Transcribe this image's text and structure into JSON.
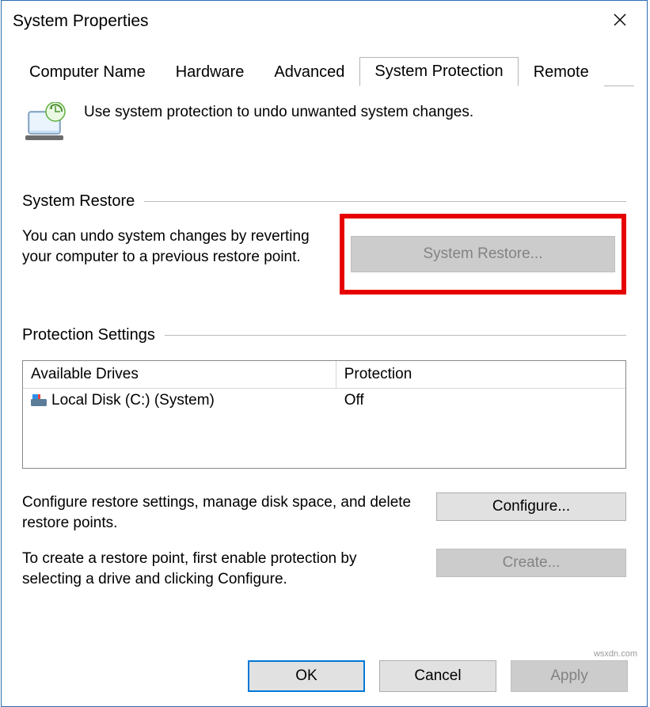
{
  "window": {
    "title": "System Properties"
  },
  "tabs": {
    "items": [
      "Computer Name",
      "Hardware",
      "Advanced",
      "System Protection",
      "Remote"
    ],
    "active_index": 3
  },
  "intro": "Use system protection to undo unwanted system changes.",
  "restore": {
    "group_title": "System Restore",
    "text": "You can undo system changes by reverting your computer to a previous restore point.",
    "button": "System Restore..."
  },
  "protection": {
    "group_title": "Protection Settings",
    "columns": [
      "Available Drives",
      "Protection"
    ],
    "drives": [
      {
        "name": "Local Disk (C:) (System)",
        "status": "Off"
      }
    ],
    "configure_text": "Configure restore settings, manage disk space, and delete restore points.",
    "configure_button": "Configure...",
    "create_text": "To create a restore point, first enable protection by selecting a drive and clicking Configure.",
    "create_button": "Create..."
  },
  "footer": {
    "ok": "OK",
    "cancel": "Cancel",
    "apply": "Apply"
  },
  "watermark_src": "wsxdn.com"
}
